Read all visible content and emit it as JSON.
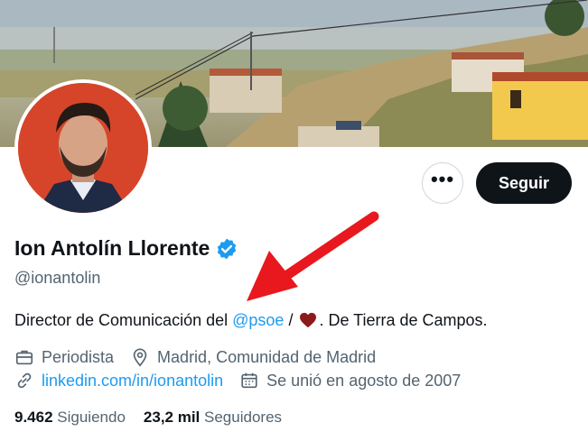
{
  "profile": {
    "display_name": "Ion Antolín Llorente",
    "handle": "@ionantolin",
    "bio": {
      "prefix": "Director de Comunicación del ",
      "mention": "@psoe",
      "middle": " / ",
      "suffix": ". De Tierra de Campos."
    },
    "occupation": "Periodista",
    "location": "Madrid, Comunidad de Madrid",
    "website": "linkedin.com/in/ionantolin",
    "joined": "Se unió en agosto de 2007",
    "following_count": "9.462",
    "following_label": "Siguiendo",
    "followers_count": "23,2 mil",
    "followers_label": "Seguidores"
  },
  "actions": {
    "more_label": "•••",
    "follow_label": "Seguir"
  },
  "colors": {
    "accent": "#1d9bf0",
    "text_primary": "#0f1419",
    "text_secondary": "#536471",
    "annotation_arrow": "#e8181e",
    "heart": "#8b1a1a"
  },
  "icons": [
    "verified-badge-icon",
    "briefcase-icon",
    "location-pin-icon",
    "link-icon",
    "calendar-icon",
    "heart-icon",
    "more-icon"
  ]
}
